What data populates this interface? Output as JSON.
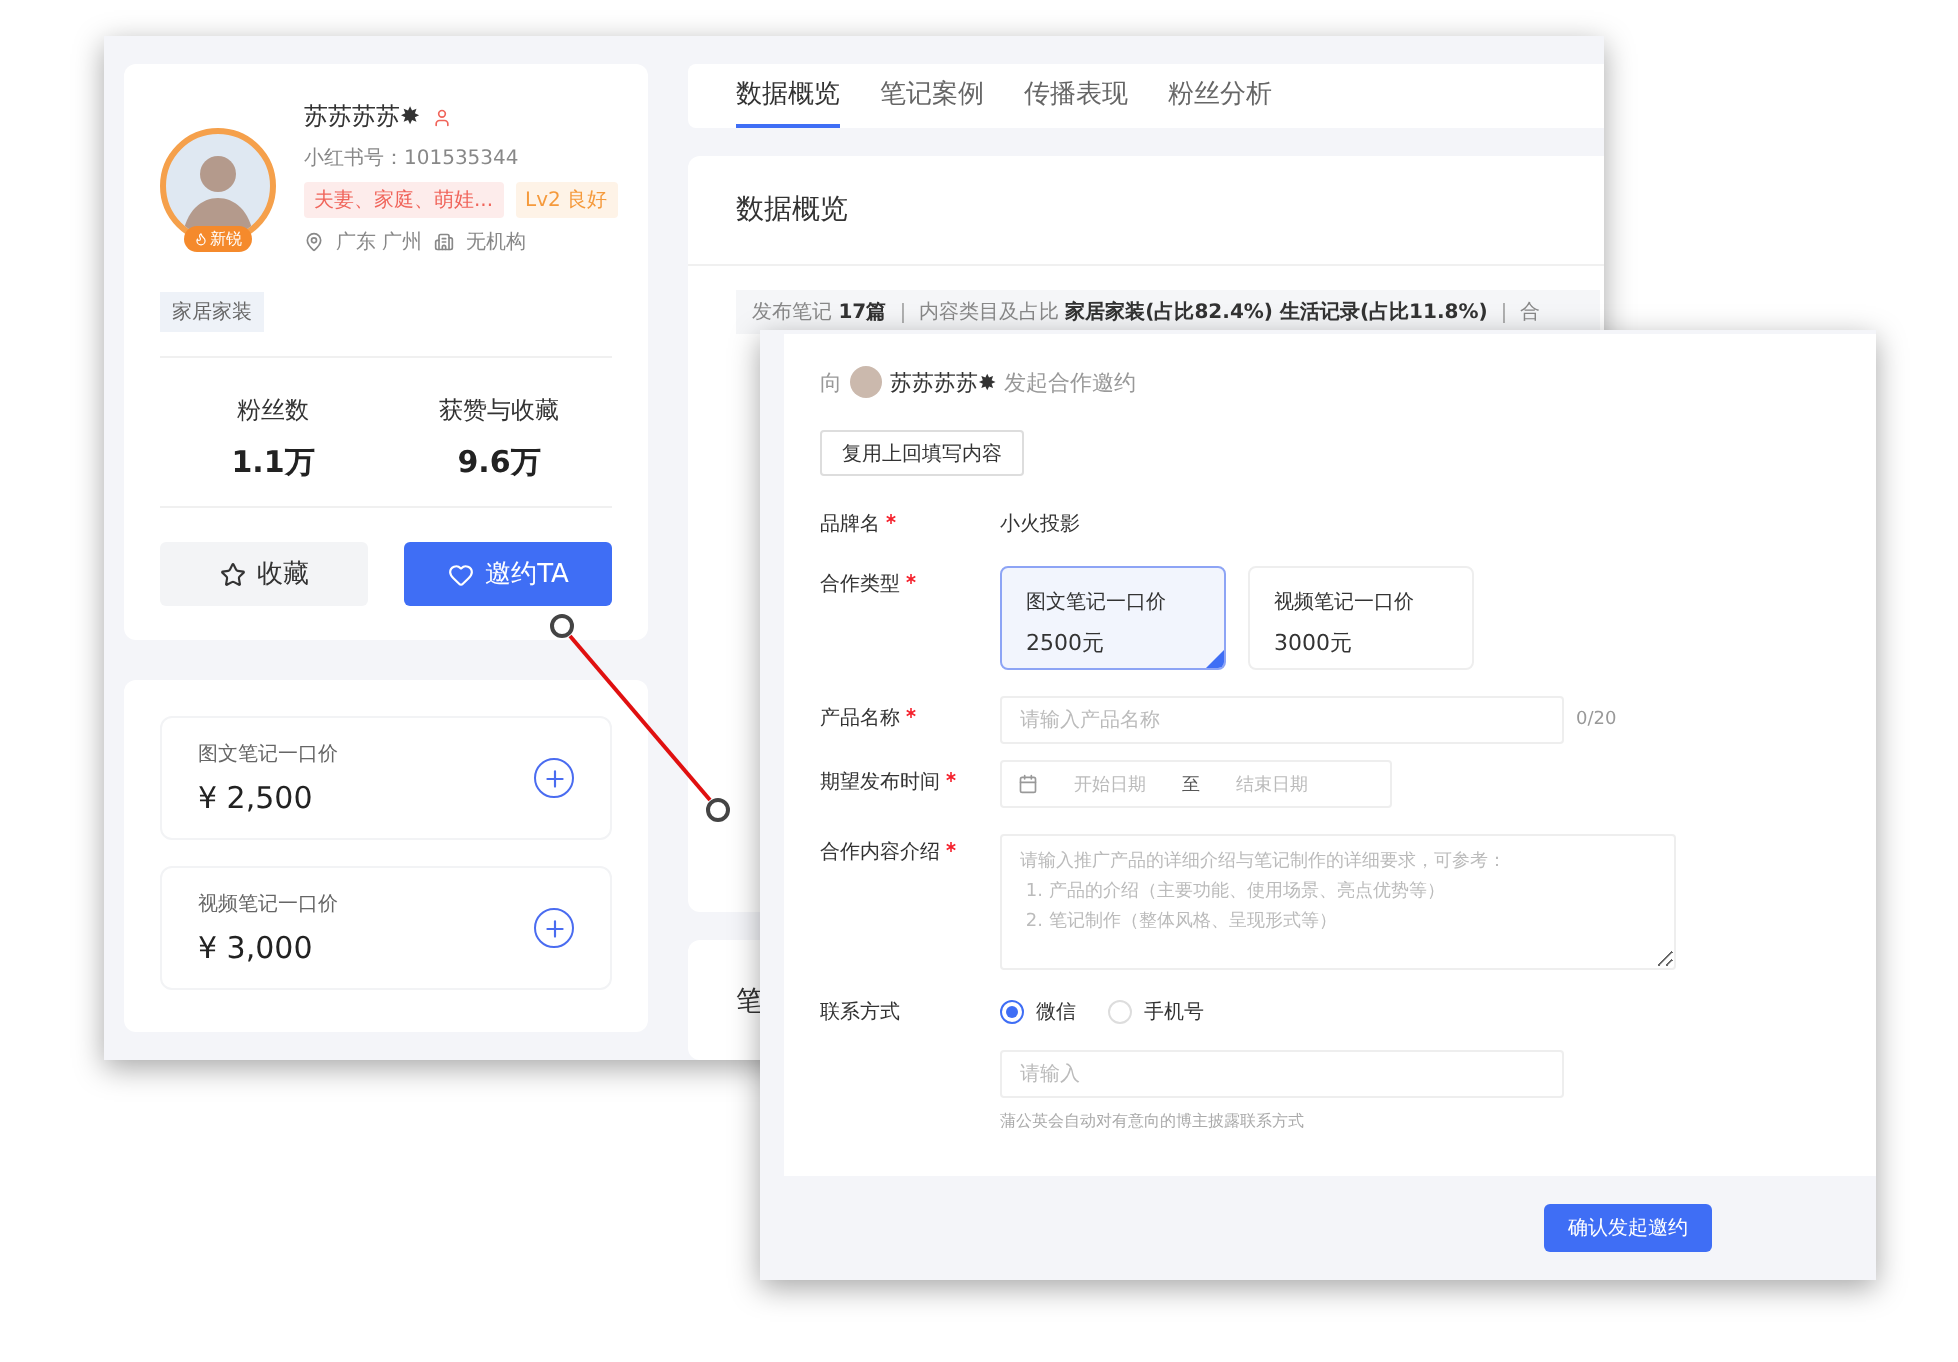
{
  "profile": {
    "name": "苏苏苏苏✸",
    "badge": "新锐",
    "account": "小红书号：101535344",
    "tags": [
      {
        "text": "夫妻、家庭、萌娃...",
        "color": "#f0645a"
      },
      {
        "text": "Lv2 良好",
        "color": "#f59a3c"
      }
    ],
    "location": "广东 广州",
    "organization": "无机构",
    "category": "家居家装",
    "stats": [
      {
        "label": "粉丝数",
        "value": "1.1万"
      },
      {
        "label": "获赞与收藏",
        "value": "9.6万"
      }
    ],
    "buttons": [
      {
        "label": "收藏",
        "kind": "secondary"
      },
      {
        "label": "邀约TA",
        "kind": "primary"
      }
    ]
  },
  "prices": [
    {
      "label": "图文笔记一口价",
      "value": "¥ 2,500"
    },
    {
      "label": "视频笔记一口价",
      "value": "¥ 3,000"
    }
  ],
  "tabs": [
    {
      "label": "数据概览",
      "selected": true
    },
    {
      "label": "笔记案例",
      "selected": false
    },
    {
      "label": "传播表现",
      "selected": false
    },
    {
      "label": "粉丝分析",
      "selected": false
    }
  ],
  "overview": {
    "title": "数据概览",
    "summary": "发布笔记 **17篇** ｜ 内容类目及占比 **家居家装(占比82.4%) 生活记录(占比11.8%)** ｜ 合"
  },
  "next_section": {
    "title": "笔"
  },
  "invite": {
    "prefix": "向",
    "name": "苏苏苏苏✸",
    "suffix": "发起合作邀约",
    "reuse_button": "复用上回填写内容",
    "brand": {
      "label": "品牌名",
      "required": true,
      "value": "小火投影"
    },
    "type": {
      "label": "合作类型",
      "required": true,
      "options": [
        {
          "title": "图文笔记一口价",
          "price": "2500元",
          "selected": true
        },
        {
          "title": "视频笔记一口价",
          "price": "3000元",
          "selected": false
        }
      ]
    },
    "product": {
      "label": "产品名称",
      "required": true,
      "placeholder": "请输入产品名称",
      "counter": "0/20"
    },
    "date": {
      "label": "期望发布时间",
      "required": true,
      "start": "开始日期",
      "separator": "至",
      "end": "结束日期"
    },
    "content": {
      "label": "合作内容介绍",
      "required": true,
      "placeholder": "请输入推广产品的详细介绍与笔记制作的详细要求，可参考：\n 1. 产品的介绍（主要功能、使用场景、亮点优势等）\n 2. 笔记制作（整体风格、呈现形式等）"
    },
    "contact": {
      "label": "联系方式",
      "required": false,
      "options": [
        {
          "label": "微信",
          "selected": true
        },
        {
          "label": "手机号",
          "selected": false
        }
      ],
      "placeholder": "请输入",
      "hint": "蒲公英会自动对有意向的博主披露联系方式"
    },
    "submit": "确认发起邀约"
  }
}
